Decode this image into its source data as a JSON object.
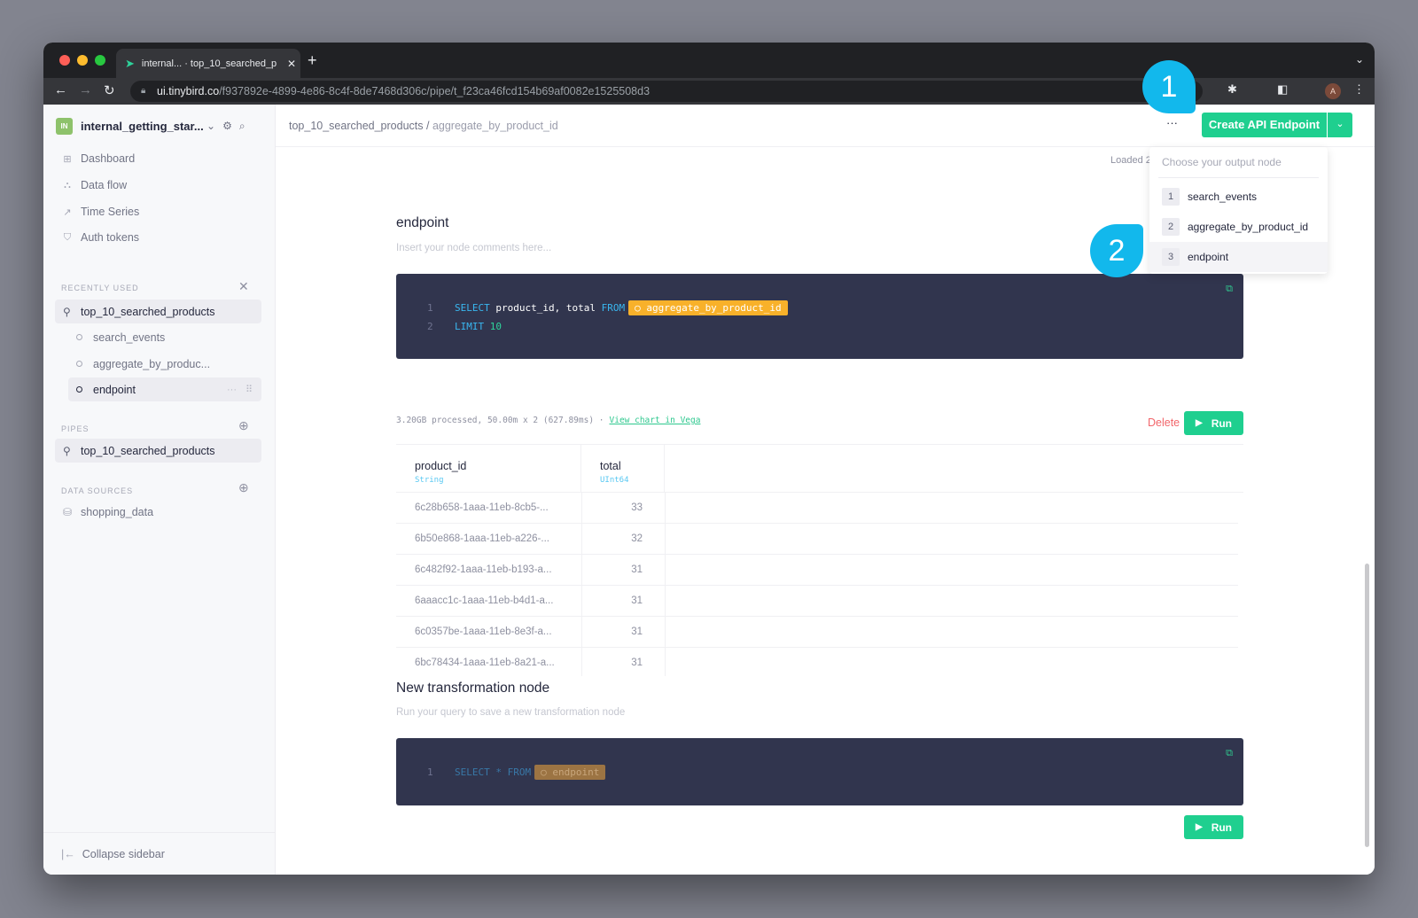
{
  "browser": {
    "tab_title": "internal... · top_10_searched_p",
    "url_host": "ui.tinybird.co",
    "url_path": "/f937892e-4899-4e86-8c4f-8de7468d306c/pipe/t_f23ca46fcd154b69af0082e1525508d3",
    "avatar_letter": "A"
  },
  "sidebar": {
    "workspace_badge": "IN",
    "workspace_name": "internal_getting_star...",
    "nav": [
      {
        "label": "Dashboard",
        "icon": "grid-icon"
      },
      {
        "label": "Data flow",
        "icon": "flow-icon"
      },
      {
        "label": "Time Series",
        "icon": "chart-icon"
      },
      {
        "label": "Auth tokens",
        "icon": "shield-icon"
      }
    ],
    "recently_used_label": "RECENTLY USED",
    "recent_pipe": "top_10_searched_products",
    "recent_nodes": [
      "search_events",
      "aggregate_by_produc...",
      "endpoint"
    ],
    "pipes_label": "PIPES",
    "pipes": [
      "top_10_searched_products"
    ],
    "data_sources_label": "DATA SOURCES",
    "data_sources": [
      "shopping_data"
    ],
    "collapse_label": "Collapse sidebar"
  },
  "header": {
    "breadcrumb_pipe": "top_10_searched_products",
    "breadcrumb_sep": " / ",
    "breadcrumb_node": "aggregate_by_product_id",
    "more_label": "···",
    "create_label": "Create API Endpoint",
    "loaded_text": "Loaded 2"
  },
  "dropdown": {
    "hint": "Choose your output node",
    "options": [
      {
        "num": "1",
        "label": "search_events"
      },
      {
        "num": "2",
        "label": "aggregate_by_product_id"
      },
      {
        "num": "3",
        "label": "endpoint"
      }
    ]
  },
  "annotations": [
    "1",
    "2"
  ],
  "endpoint_node": {
    "title": "endpoint",
    "description_placeholder": "Insert your node comments here...",
    "lines": [
      {
        "n": "1",
        "kw1": "SELECT",
        "text": " product_id, total ",
        "kw2": "FROM",
        "ref": "○ aggregate_by_product_id"
      },
      {
        "n": "2",
        "kw1": "LIMIT",
        "num": "10"
      }
    ],
    "stats": "3.20GB processed, 50.00m x 2 (627.89ms) ·",
    "vega_link": "View chart in Vega",
    "delete_label": "Delete",
    "run_label": "Run",
    "columns": [
      {
        "name": "product_id",
        "type": "String"
      },
      {
        "name": "total",
        "type": "UInt64"
      }
    ],
    "rows": [
      {
        "product_id": "6c28b658-1aaa-11eb-8cb5-...",
        "total": "33"
      },
      {
        "product_id": "6b50e868-1aaa-11eb-a226-...",
        "total": "32"
      },
      {
        "product_id": "6c482f92-1aaa-11eb-b193-a...",
        "total": "31"
      },
      {
        "product_id": "6aaacc1c-1aaa-11eb-b4d1-a...",
        "total": "31"
      },
      {
        "product_id": "6c0357be-1aaa-11eb-8e3f-a...",
        "total": "31"
      },
      {
        "product_id": "6bc78434-1aaa-11eb-8a21-a...",
        "total": "31"
      }
    ]
  },
  "new_node": {
    "title": "New transformation node",
    "description": "Run your query to save a new transformation node",
    "line_num": "1",
    "kw1": "SELECT",
    "star": " * ",
    "kw2": "FROM",
    "ref": "○ endpoint",
    "run_label": "Run"
  }
}
